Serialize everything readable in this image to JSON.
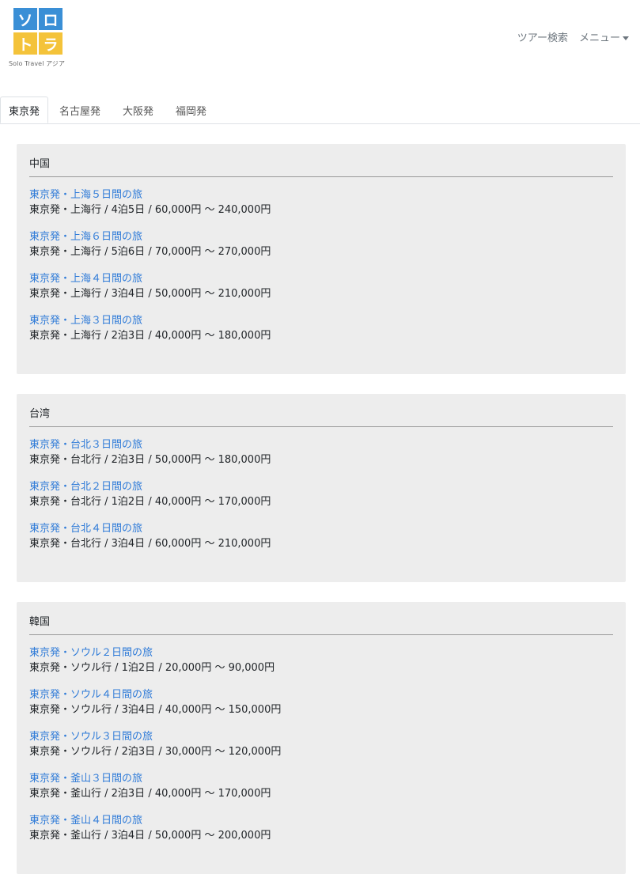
{
  "logo": {
    "chars": [
      "ソ",
      "ロ",
      "ト",
      "ラ"
    ],
    "text": "Solo Travel アジア",
    "colors": {
      "top": "#3a8fd6",
      "bottom": "#f4c33a"
    }
  },
  "nav": {
    "search": "ツアー検索",
    "menu": "メニュー"
  },
  "tabs": [
    "東京発",
    "名古屋発",
    "大阪発",
    "福岡発"
  ],
  "regions": [
    {
      "title": "中国",
      "tours": [
        {
          "name": "東京発・上海５日間の旅",
          "info": "東京発・上海行 / 4泊5日 / 60,000円 〜 240,000円"
        },
        {
          "name": "東京発・上海６日間の旅",
          "info": "東京発・上海行 / 5泊6日 / 70,000円 〜 270,000円"
        },
        {
          "name": "東京発・上海４日間の旅",
          "info": "東京発・上海行 / 3泊4日 / 50,000円 〜 210,000円"
        },
        {
          "name": "東京発・上海３日間の旅",
          "info": "東京発・上海行 / 2泊3日 / 40,000円 〜 180,000円"
        }
      ]
    },
    {
      "title": "台湾",
      "tours": [
        {
          "name": "東京発・台北３日間の旅",
          "info": "東京発・台北行 / 2泊3日 / 50,000円 〜 180,000円"
        },
        {
          "name": "東京発・台北２日間の旅",
          "info": "東京発・台北行 / 1泊2日 / 40,000円 〜 170,000円"
        },
        {
          "name": "東京発・台北４日間の旅",
          "info": "東京発・台北行 / 3泊4日 / 60,000円 〜 210,000円"
        }
      ]
    },
    {
      "title": "韓国",
      "tours": [
        {
          "name": "東京発・ソウル２日間の旅",
          "info": "東京発・ソウル行 / 1泊2日 / 20,000円 〜 90,000円"
        },
        {
          "name": "東京発・ソウル４日間の旅",
          "info": "東京発・ソウル行 / 3泊4日 / 40,000円 〜 150,000円"
        },
        {
          "name": "東京発・ソウル３日間の旅",
          "info": "東京発・ソウル行 / 2泊3日 / 30,000円 〜 120,000円"
        },
        {
          "name": "東京発・釜山３日間の旅",
          "info": "東京発・釜山行 / 2泊3日 / 40,000円 〜 170,000円"
        },
        {
          "name": "東京発・釜山４日間の旅",
          "info": "東京発・釜山行 / 3泊4日 / 50,000円 〜 200,000円"
        }
      ]
    }
  ]
}
